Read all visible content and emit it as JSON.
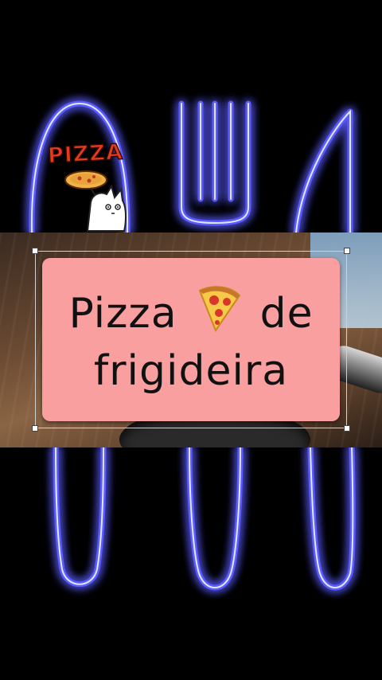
{
  "sticker": {
    "label": "PIZZA",
    "icon": "cartoon-cat-holding-pizza"
  },
  "title": {
    "line1": "Pizza",
    "line2": "de",
    "line3": "frigideira",
    "emoji": "pizza-slice"
  },
  "colors": {
    "neon": "#3a3bff",
    "card": "#fa9f9f",
    "background": "#000000"
  }
}
